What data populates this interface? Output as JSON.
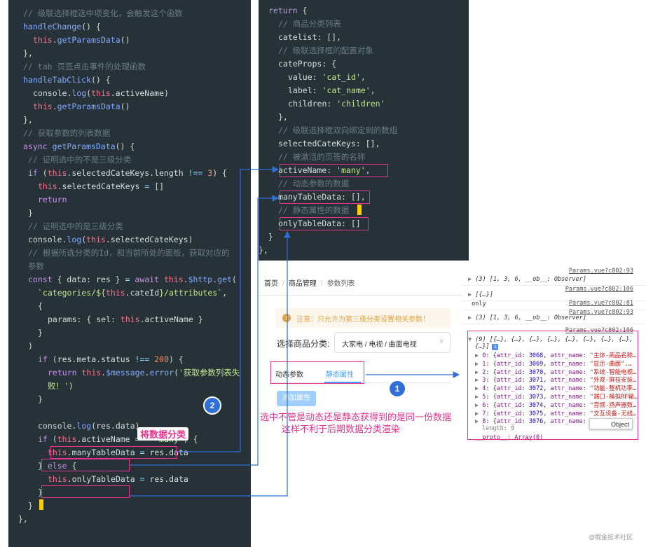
{
  "left_code_lines": [
    {
      "indent": 3,
      "tokens": [
        [
          "cm",
          "// 级联选择框选中项变化，会触发这个函数"
        ]
      ]
    },
    {
      "indent": 3,
      "tokens": [
        [
          "fn",
          "handleChange"
        ],
        [
          "pu",
          "() {"
        ]
      ]
    },
    {
      "indent": 5,
      "tokens": [
        [
          "th",
          "this"
        ],
        [
          "pu",
          "."
        ],
        [
          "fn",
          "getParamsData"
        ],
        [
          "pu",
          "()"
        ]
      ]
    },
    {
      "indent": 3,
      "tokens": [
        [
          "pu",
          "},"
        ]
      ]
    },
    {
      "indent": 3,
      "tokens": [
        [
          "cm",
          "// tab 页签点击事件的处理函数"
        ]
      ]
    },
    {
      "indent": 3,
      "tokens": [
        [
          "fn",
          "handleTabClick"
        ],
        [
          "pu",
          "() {"
        ]
      ]
    },
    {
      "indent": 5,
      "tokens": [
        [
          "df",
          "console"
        ],
        [
          "pu",
          "."
        ],
        [
          "fn",
          "log"
        ],
        [
          "pu",
          "("
        ],
        [
          "th",
          "this"
        ],
        [
          "pu",
          "."
        ],
        [
          "pr",
          "activeName"
        ],
        [
          "pu",
          ")"
        ]
      ]
    },
    {
      "indent": 5,
      "tokens": [
        [
          "th",
          "this"
        ],
        [
          "pu",
          "."
        ],
        [
          "fn",
          "getParamsData"
        ],
        [
          "pu",
          "()"
        ]
      ]
    },
    {
      "indent": 3,
      "tokens": [
        [
          "pu",
          "},"
        ]
      ]
    },
    {
      "indent": 3,
      "tokens": [
        [
          "cm",
          "// 获取参数的列表数据"
        ]
      ]
    },
    {
      "indent": 3,
      "tokens": [
        [
          "kw",
          "async "
        ],
        [
          "fn",
          "getParamsData"
        ],
        [
          "pu",
          "() {"
        ]
      ]
    },
    {
      "indent": 4,
      "tokens": [
        [
          "cm",
          "// 证明选中的不是三级分类"
        ]
      ]
    },
    {
      "indent": 4,
      "tokens": [
        [
          "kw",
          "if "
        ],
        [
          "pu",
          "("
        ],
        [
          "th",
          "this"
        ],
        [
          "pu",
          "."
        ],
        [
          "pr",
          "selectedCateKeys"
        ],
        [
          "pu",
          "."
        ],
        [
          "pr",
          "length "
        ],
        [
          "op",
          "!== "
        ],
        [
          "nm",
          "3"
        ],
        [
          "pu",
          ") {"
        ]
      ]
    },
    {
      "indent": 6,
      "tokens": [
        [
          "th",
          "this"
        ],
        [
          "pu",
          "."
        ],
        [
          "pr",
          "selectedCateKeys "
        ],
        [
          "op",
          "= "
        ],
        [
          "pu",
          "[]"
        ]
      ]
    },
    {
      "indent": 6,
      "tokens": [
        [
          "kw",
          "return"
        ]
      ]
    },
    {
      "indent": 4,
      "tokens": [
        [
          "pu",
          "}"
        ]
      ]
    },
    {
      "indent": 4,
      "tokens": [
        [
          "cm",
          "// 证明选中的是三级分类"
        ]
      ]
    },
    {
      "indent": 4,
      "tokens": [
        [
          "df",
          "console"
        ],
        [
          "pu",
          "."
        ],
        [
          "fn",
          "log"
        ],
        [
          "pu",
          "("
        ],
        [
          "th",
          "this"
        ],
        [
          "pu",
          "."
        ],
        [
          "pr",
          "selectedCateKeys"
        ],
        [
          "pu",
          ")"
        ]
      ]
    },
    {
      "indent": 4,
      "tokens": [
        [
          "cm",
          "// 根据所选分类的Id，和当前所处的面板，获取对应的"
        ]
      ]
    },
    {
      "indent": 4,
      "tokens": [
        [
          "cm",
          "参数"
        ]
      ]
    },
    {
      "indent": 4,
      "tokens": [
        [
          "kw",
          "const "
        ],
        [
          "pu",
          "{ "
        ],
        [
          "pr",
          "data"
        ],
        [
          "pu",
          ": "
        ],
        [
          "pr",
          "res "
        ],
        [
          "pu",
          "} "
        ],
        [
          "op",
          "= "
        ],
        [
          "kw",
          "await "
        ],
        [
          "th",
          "this"
        ],
        [
          "pu",
          "."
        ],
        [
          "fn",
          "$http"
        ],
        [
          "pu",
          "."
        ],
        [
          "fn",
          "get"
        ],
        [
          "pu",
          "("
        ]
      ]
    },
    {
      "indent": 6,
      "tokens": [
        [
          "st",
          "`categories/${"
        ],
        [
          "th",
          "this"
        ],
        [
          "pu",
          "."
        ],
        [
          "pr",
          "cateId"
        ],
        [
          "st",
          "}/attributes`"
        ],
        [
          "pu",
          ","
        ]
      ]
    },
    {
      "indent": 6,
      "tokens": [
        [
          "pu",
          "{"
        ]
      ]
    },
    {
      "indent": 8,
      "tokens": [
        [
          "pr",
          "params"
        ],
        [
          "pu",
          ": { "
        ],
        [
          "pr",
          "sel"
        ],
        [
          "pu",
          ": "
        ],
        [
          "th",
          "this"
        ],
        [
          "pu",
          "."
        ],
        [
          "pr",
          "activeName "
        ],
        [
          "pu",
          "}"
        ]
      ]
    },
    {
      "indent": 6,
      "tokens": [
        [
          "pu",
          "}"
        ]
      ]
    },
    {
      "indent": 4,
      "tokens": [
        [
          "pu",
          ")"
        ]
      ]
    },
    {
      "indent": 6,
      "tokens": [
        [
          "kw",
          "if "
        ],
        [
          "pu",
          "("
        ],
        [
          "pr",
          "res"
        ],
        [
          "pu",
          "."
        ],
        [
          "pr",
          "meta"
        ],
        [
          "pu",
          "."
        ],
        [
          "pr",
          "status "
        ],
        [
          "op",
          "!== "
        ],
        [
          "nm",
          "200"
        ],
        [
          "pu",
          ") {"
        ]
      ]
    },
    {
      "indent": 8,
      "tokens": [
        [
          "kw",
          "return "
        ],
        [
          "th",
          "this"
        ],
        [
          "pu",
          "."
        ],
        [
          "fn",
          "$message"
        ],
        [
          "pu",
          "."
        ],
        [
          "fn",
          "error"
        ],
        [
          "pu",
          "("
        ],
        [
          "st",
          "'获取参数列表失"
        ]
      ]
    },
    {
      "indent": 8,
      "tokens": [
        [
          "st",
          "败！')"
        ]
      ]
    },
    {
      "indent": 6,
      "tokens": [
        [
          "pu",
          "}"
        ]
      ]
    },
    {
      "indent": 0,
      "tokens": []
    },
    {
      "indent": 6,
      "tokens": [
        [
          "df",
          "console"
        ],
        [
          "pu",
          "."
        ],
        [
          "fn",
          "log"
        ],
        [
          "pu",
          "("
        ],
        [
          "pr",
          "res"
        ],
        [
          "pu",
          "."
        ],
        [
          "pr",
          "data"
        ],
        [
          "pu",
          ")"
        ]
      ]
    },
    {
      "indent": 6,
      "tokens": [
        [
          "kw",
          "if "
        ],
        [
          "pu",
          "("
        ],
        [
          "th",
          "this"
        ],
        [
          "pu",
          "."
        ],
        [
          "pr",
          "activeName "
        ],
        [
          "op",
          "=== "
        ],
        [
          "st",
          "'many'"
        ],
        [
          "pu",
          ") {"
        ]
      ]
    },
    {
      "indent": 8,
      "tokens": [
        [
          "th",
          "this"
        ],
        [
          "pu",
          "."
        ],
        [
          "pr",
          "manyTableData "
        ],
        [
          "op",
          "= "
        ],
        [
          "pr",
          "res"
        ],
        [
          "pu",
          "."
        ],
        [
          "pr",
          "data"
        ]
      ]
    },
    {
      "indent": 6,
      "tokens": [
        [
          "pu",
          "} "
        ],
        [
          "kw",
          "else "
        ],
        [
          "pu",
          "{"
        ]
      ]
    },
    {
      "indent": 8,
      "tokens": [
        [
          "th",
          "this"
        ],
        [
          "pu",
          "."
        ],
        [
          "pr",
          "onlyTableData "
        ],
        [
          "op",
          "= "
        ],
        [
          "pr",
          "res"
        ],
        [
          "pu",
          "."
        ],
        [
          "pr",
          "data"
        ]
      ]
    },
    {
      "indent": 6,
      "tokens": [
        [
          "pu",
          "}"
        ]
      ]
    },
    {
      "indent": 4,
      "tokens": [
        [
          "pu",
          "}"
        ]
      ]
    },
    {
      "indent": 2,
      "tokens": [
        [
          "pu",
          "},"
        ]
      ]
    }
  ],
  "right_code_lines": [
    {
      "indent": 2,
      "tokens": [
        [
          "kw",
          "return "
        ],
        [
          "pu",
          "{"
        ]
      ]
    },
    {
      "indent": 4,
      "tokens": [
        [
          "cm",
          "// 商品分类列表"
        ]
      ]
    },
    {
      "indent": 4,
      "tokens": [
        [
          "pr",
          "catelist"
        ],
        [
          "pu",
          ": [],"
        ]
      ]
    },
    {
      "indent": 4,
      "tokens": [
        [
          "cm",
          "// 级联选择框的配置对象"
        ]
      ]
    },
    {
      "indent": 4,
      "tokens": [
        [
          "pr",
          "cateProps"
        ],
        [
          "pu",
          ": {"
        ]
      ]
    },
    {
      "indent": 6,
      "tokens": [
        [
          "pr",
          "value"
        ],
        [
          "pu",
          ": "
        ],
        [
          "st",
          "'cat_id'"
        ],
        [
          "pu",
          ","
        ]
      ]
    },
    {
      "indent": 6,
      "tokens": [
        [
          "pr",
          "label"
        ],
        [
          "pu",
          ": "
        ],
        [
          "st",
          "'cat_name'"
        ],
        [
          "pu",
          ","
        ]
      ]
    },
    {
      "indent": 6,
      "tokens": [
        [
          "pr",
          "children"
        ],
        [
          "pu",
          ": "
        ],
        [
          "st",
          "'children'"
        ]
      ]
    },
    {
      "indent": 4,
      "tokens": [
        [
          "pu",
          "},"
        ]
      ]
    },
    {
      "indent": 4,
      "tokens": [
        [
          "cm",
          "// 级联选择框双向绑定到的数组"
        ]
      ]
    },
    {
      "indent": 4,
      "tokens": [
        [
          "pr",
          "selectedCateKeys"
        ],
        [
          "pu",
          ": [],"
        ]
      ]
    },
    {
      "indent": 4,
      "tokens": [
        [
          "cm",
          "// 被激活的页签的名称"
        ]
      ]
    },
    {
      "indent": 4,
      "tokens": [
        [
          "pr",
          "activeName"
        ],
        [
          "pu",
          ": "
        ],
        [
          "st",
          "'many'"
        ],
        [
          "pu",
          ","
        ]
      ]
    },
    {
      "indent": 4,
      "tokens": [
        [
          "cm",
          "// 动态参数的数据"
        ]
      ]
    },
    {
      "indent": 4,
      "tokens": [
        [
          "pr",
          "manyTableData"
        ],
        [
          "pu",
          ": [],"
        ]
      ]
    },
    {
      "indent": 4,
      "tokens": [
        [
          "cm",
          "// 静态属性的数据"
        ]
      ]
    },
    {
      "indent": 4,
      "tokens": [
        [
          "pr",
          "onlyTableData"
        ],
        [
          "pu",
          ": []"
        ]
      ]
    },
    {
      "indent": 2,
      "tokens": [
        [
          "pu",
          "}"
        ]
      ]
    },
    {
      "indent": 0,
      "tokens": [
        [
          "pu",
          "},"
        ]
      ]
    }
  ],
  "ui": {
    "breadcrumb": [
      "首页",
      "商品管理",
      "参数列表"
    ],
    "breadcrumb_sep": "/",
    "alert_icon": "!",
    "alert_text": "注意：只允许为第三级分类设置相关参数！",
    "select_label": "选择商品分类:",
    "select_value": "大家电 / 电视 / 曲面电视",
    "select_chevron": "∨",
    "tabs": [
      "动态参数",
      "静态属性"
    ],
    "add_button": "添加属性"
  },
  "console": {
    "rows": [
      {
        "arrow": "▶",
        "text": "(3) [1, 3, 6, __ob__: Observer]",
        "source": "Params.vue?c802:93"
      },
      {
        "arrow": "▶",
        "text": "[{…}]",
        "source": "Params.vue?c802:106"
      },
      {
        "arrow": "",
        "text": "only",
        "source": "Params.vue?c802:81"
      },
      {
        "arrow": "▶",
        "text": "(3) [1, 3, 6, __ob__: Observer]",
        "source": "Params.vue?c802:93"
      }
    ],
    "last_source": "Params.vue?c802:106",
    "expanded_head": "(9) [{…}, {…}, {…}, {…}, {…}, {…}, {…}, {…},",
    "expanded_head2": "{…}]",
    "info_badge": "i",
    "items": [
      {
        "idx": "0",
        "id": "3068",
        "name": "\"主体-商品名称…"
      },
      {
        "idx": "1",
        "id": "3069",
        "name": "\"显示-曲面\",…"
      },
      {
        "idx": "2",
        "id": "3070",
        "name": "\"系统-智能电视…"
      },
      {
        "idx": "3",
        "id": "3071",
        "name": "\"外观-屏挂安装…"
      },
      {
        "idx": "4",
        "id": "3072",
        "name": "\"功能-整机功率…"
      },
      {
        "idx": "5",
        "id": "3073",
        "name": "\"端口-模拟RF输…"
      },
      {
        "idx": "6",
        "id": "3074",
        "name": "\"音频-扬声器数…"
      },
      {
        "idx": "7",
        "id": "3075",
        "name": "\"交互设备-无线…"
      },
      {
        "idx": "8",
        "id": "3076",
        "name": "\"互联…"
      }
    ],
    "length_text": "length: 9",
    "proto_text": "__proto__: Array(0)",
    "tooltip": "Object"
  },
  "annotations": {
    "classify": "将数据分类",
    "problem_line1": "选中不管是动态还是静态获得到的是同一份数据",
    "problem_line2": "这样不利于后期数据分类渲染",
    "badge1": "1",
    "badge2": "2"
  },
  "watermark": "@掘金技术社区",
  "colors": {
    "editor_bg": "#263238",
    "highlight": "#e8348f",
    "arrow": "#2f6fd6",
    "accent": "#409eff"
  }
}
